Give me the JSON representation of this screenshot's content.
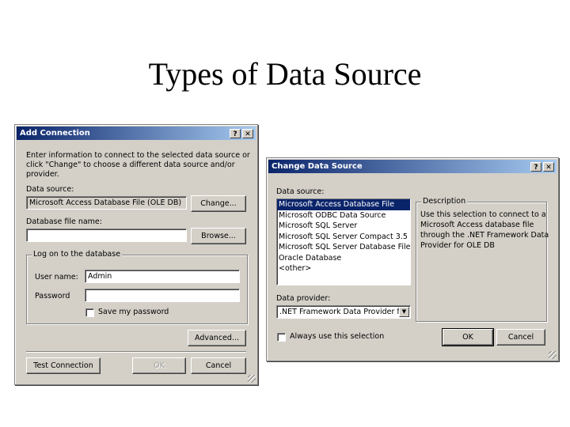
{
  "slide": {
    "title": "Types of Data Source"
  },
  "add_connection": {
    "title": "Add Connection",
    "help_button": "?",
    "close_button": "✕",
    "intro_line1": "Enter information to connect to the selected data source or",
    "intro_line2": "click \"Change\" to choose a different data source and/or",
    "intro_line3": "provider.",
    "data_source_label": "Data source:",
    "data_source_value": "Microsoft Access Database File (OLE DB)",
    "change_button": "Change...",
    "db_file_label": "Database file name:",
    "db_file_value": "",
    "browse_button": "Browse...",
    "logon_group": "Log on to the database",
    "user_name_label": "User name:",
    "user_name_value": "Admin",
    "password_label": "Password",
    "password_value": "",
    "save_password_label": "Save my password",
    "advanced_button": "Advanced...",
    "test_connection_button": "Test Connection",
    "ok_button": "OK",
    "cancel_button": "Cancel"
  },
  "change_data_source": {
    "title": "Change Data Source",
    "help_button": "?",
    "close_button": "✕",
    "data_source_label": "Data source:",
    "data_sources": [
      "Microsoft Access Database File",
      "Microsoft ODBC Data Source",
      "Microsoft SQL Server",
      "Microsoft SQL Server Compact 3.5",
      "Microsoft SQL Server Database File",
      "Oracle Database",
      "<other>"
    ],
    "description_group": "Description",
    "description_line1": "Use this selection to connect to a",
    "description_line2": "Microsoft Access database file",
    "description_line3": "through the .NET Framework Data",
    "description_line4": "Provider for OLE DB",
    "data_provider_label": "Data provider:",
    "data_provider_value": ".NET Framework Data Provider for OLE DB",
    "always_use_label": "Always use this selection",
    "ok_button": "OK",
    "cancel_button": "Cancel"
  }
}
